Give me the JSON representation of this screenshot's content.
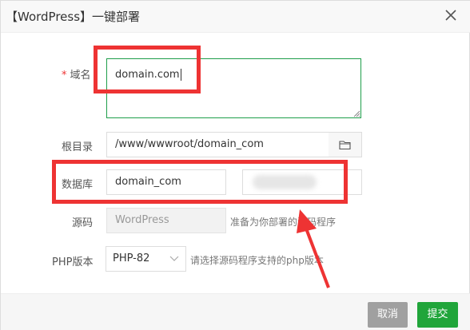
{
  "dialog": {
    "title": "【WordPress】一键部署",
    "close_icon": "close-icon"
  },
  "form": {
    "domain": {
      "label": "域名",
      "required_mark": "*",
      "value": "domain.com"
    },
    "root_dir": {
      "label": "根目录",
      "value": "/www/wwwroot/domain_com",
      "button_icon": "folder-icon"
    },
    "database": {
      "label": "数据库",
      "name_value": "domain_com",
      "password_value": ""
    },
    "source": {
      "label": "源码",
      "value": "WordPress",
      "hint": "准备为你部署的源码程序"
    },
    "php_version": {
      "label": "PHP版本",
      "selected": "PHP-82",
      "hint": "请选择源码程序支持的php版本"
    }
  },
  "footer": {
    "cancel_label": "取消",
    "submit_label": "提交"
  },
  "annotation": {
    "box_color": "#ee3333",
    "arrow_color": "#ee3333"
  }
}
